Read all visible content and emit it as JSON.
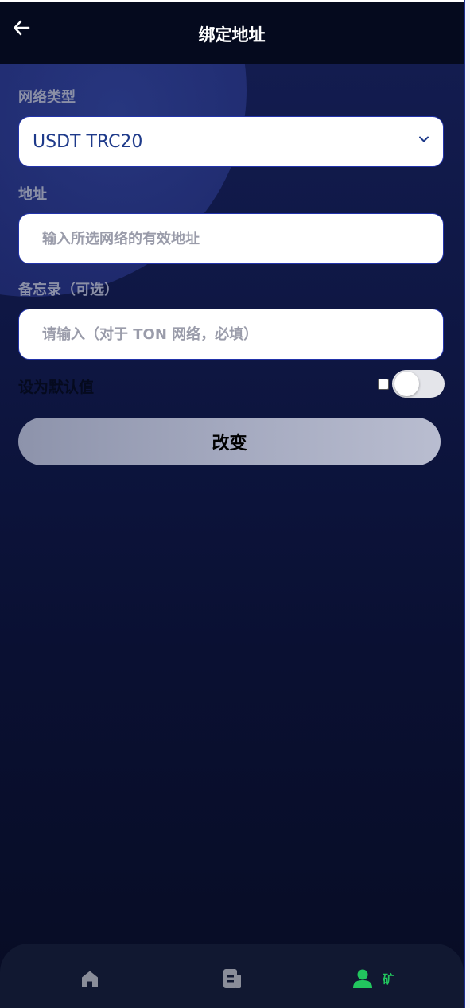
{
  "header": {
    "title": "绑定地址"
  },
  "form": {
    "network_label": "网络类型",
    "network_value": "USDT TRC20",
    "address_label": "地址",
    "address_placeholder": "输入所选网络的有效地址",
    "memo_label": "备忘录（可选）",
    "memo_placeholder": "请输入（对于 TON 网络，必填）",
    "default_label": "设为默认值",
    "default_checked": false,
    "submit_label": "改变"
  },
  "tabbar": {
    "items": [
      {
        "icon": "home-icon",
        "label": "",
        "active": false
      },
      {
        "icon": "document-icon",
        "label": "",
        "active": false
      },
      {
        "icon": "user-icon",
        "label": "矿",
        "active": true
      }
    ]
  },
  "colors": {
    "active": "#22c55e",
    "inactive": "#8a8d99",
    "accent_border": "#2233aa"
  }
}
